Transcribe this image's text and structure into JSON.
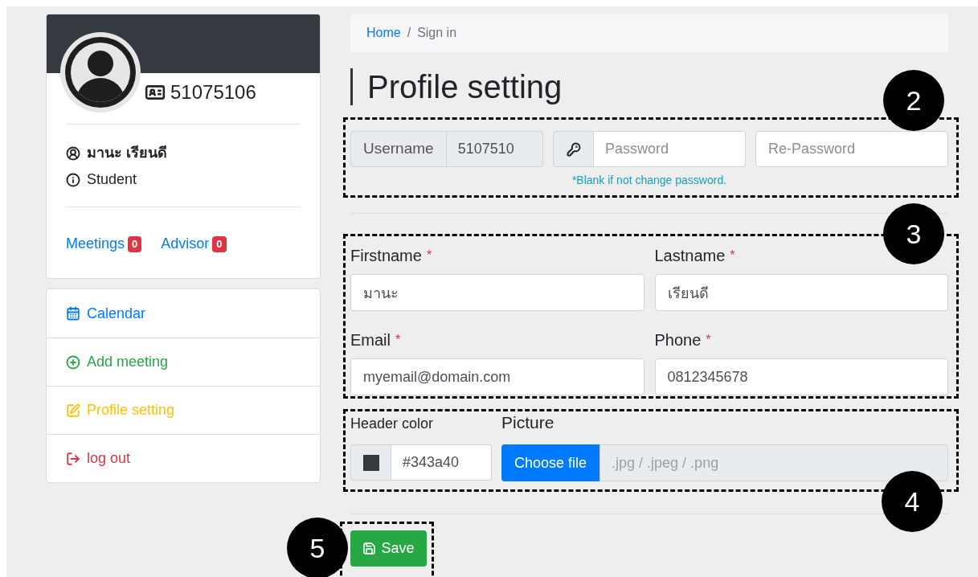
{
  "profile": {
    "id": "51075106",
    "name": "มานะ เรียนดี",
    "role": "Student",
    "links": [
      {
        "label": "Meetings",
        "count": "0"
      },
      {
        "label": "Advisor",
        "count": "0"
      }
    ]
  },
  "menu": [
    {
      "label": "Calendar",
      "color": "#007bff"
    },
    {
      "label": "Add meeting",
      "color": "#28a745"
    },
    {
      "label": "Profile setting",
      "color": "#ffc107"
    },
    {
      "label": "log out",
      "color": "#dc3545"
    }
  ],
  "breadcrumb": [
    {
      "label": "Home",
      "selected": false
    },
    {
      "separator": "/",
      "label": "Sign in",
      "selected": true
    }
  ],
  "page_title": "Profile setting",
  "account": {
    "username_label": "Username",
    "username_value": "5107510",
    "password_placeholder": "Password",
    "repassword_placeholder": "Re-Password",
    "hint": "*Blank if not change password."
  },
  "fields": [
    {
      "label": "Firstname",
      "required_mark": "*",
      "value": "มานะ"
    },
    {
      "label": "Lastname",
      "required_mark": "*",
      "value": "เรียนดี"
    },
    {
      "label": "Email",
      "required_mark": "*",
      "value": "myemail@domain.com"
    },
    {
      "label": "Phone",
      "required_mark": "*",
      "value": "0812345678"
    }
  ],
  "header_color": {
    "label": "Header color",
    "value": "#343a40"
  },
  "picture": {
    "label": "Picture",
    "button": "Choose file",
    "placeholder": ".jpg / .jpeg / .png"
  },
  "save_button": "Save",
  "callouts": [
    "2",
    "3",
    "4",
    "5"
  ]
}
